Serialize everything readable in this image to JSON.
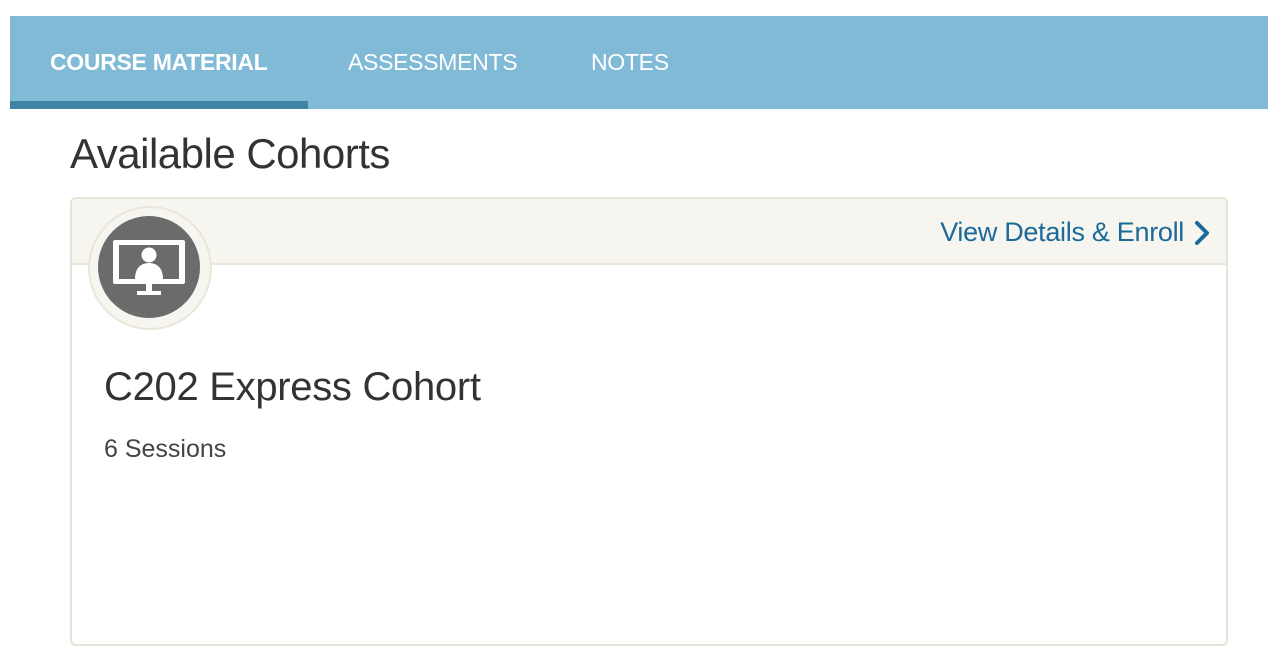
{
  "tabs": [
    {
      "label": "COURSE MATERIAL",
      "active": true
    },
    {
      "label": "ASSESSMENTS",
      "active": false
    },
    {
      "label": "NOTES",
      "active": false
    }
  ],
  "page": {
    "title": "Available Cohorts"
  },
  "cohort": {
    "name": "C202 Express Cohort",
    "sessions": "6 Sessions",
    "enroll_label": "View Details & Enroll",
    "icon": "monitor-user-icon",
    "chevron_icon": "chevron-right-icon"
  },
  "colors": {
    "tabbar": "#81bad6",
    "tab_indicator": "#3f84a2",
    "link": "#1b6a9a",
    "card_header": "#f6f5ef",
    "card_border": "#e6e4d6",
    "avatar": "#6b6b6b"
  }
}
